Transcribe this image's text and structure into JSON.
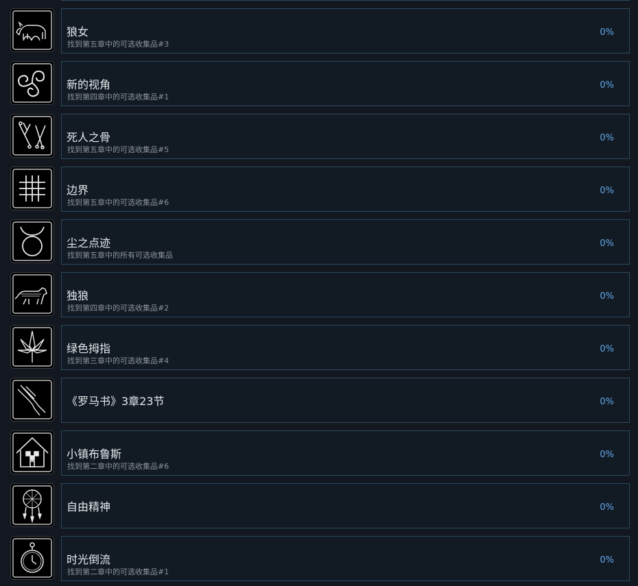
{
  "achievements": [
    {
      "title": "狼女",
      "description": "找到第五章中的可选收集品#3",
      "percent": "0%",
      "icon": "wolf-twins-icon"
    },
    {
      "title": "新的视角",
      "description": "找到第四章中的可选收集品#1",
      "percent": "0%",
      "icon": "triskelion-icon"
    },
    {
      "title": "死人之骨",
      "description": "找到第五章中的可选收集品#5",
      "percent": "0%",
      "icon": "bones-icon"
    },
    {
      "title": "边界",
      "description": "找到第五章中的可选收集品#6",
      "percent": "0%",
      "icon": "grid-icon"
    },
    {
      "title": "尘之点迹",
      "description": "找到第五章中的所有可选收集品",
      "percent": "0%",
      "icon": "taurus-symbol-icon"
    },
    {
      "title": "独狼",
      "description": "找到第四章中的可选收集品#2",
      "percent": "0%",
      "icon": "wolf-icon"
    },
    {
      "title": "绿色拇指",
      "description": "找到第三章中的可选收集品#4",
      "percent": "0%",
      "icon": "cannabis-leaf-icon"
    },
    {
      "title": "《罗马书》3章23节",
      "description": "",
      "percent": "0%",
      "icon": "praying-hands-icon"
    },
    {
      "title": "小镇布鲁斯",
      "description": "找到第二章中的可选收集品#6",
      "percent": "0%",
      "icon": "house-icon"
    },
    {
      "title": "自由精神",
      "description": "",
      "percent": "0%",
      "icon": "dreamcatcher-icon"
    },
    {
      "title": "时光倒流",
      "description": "找到第二章中的可选收集品#1",
      "percent": "0%",
      "icon": "pocket-watch-icon"
    }
  ]
}
